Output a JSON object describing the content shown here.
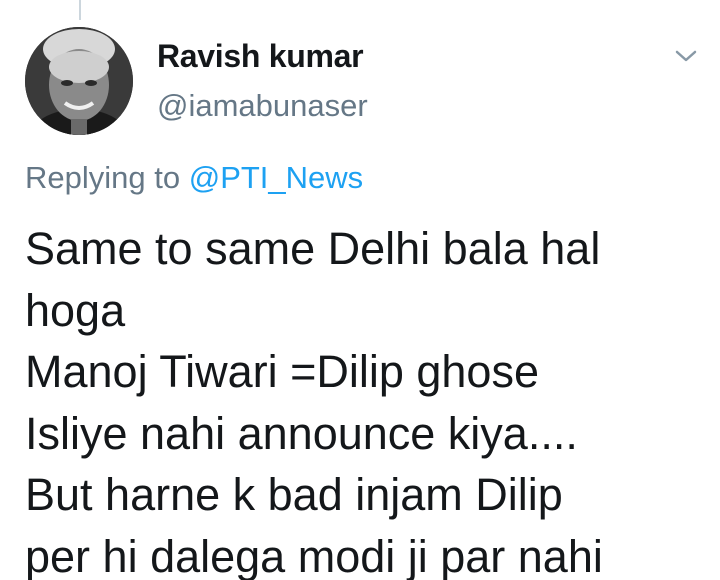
{
  "author": {
    "name": "Ravish kumar",
    "handle": "@iamabunaser",
    "avatar_icon": "profile-avatar"
  },
  "menu": {
    "icon": "chevron-down-icon"
  },
  "reply": {
    "prefix": "Replying to",
    "mention": "@PTI_News"
  },
  "tweet": {
    "lines": [
      "Same to same Delhi bala hal",
      "hoga",
      "Manoj Tiwari =Dilip ghose",
      "Isliye nahi announce kiya....",
      "But harne k bad injam Dilip",
      "per hi dalega modi ji par nahi"
    ]
  },
  "colors": {
    "text": "#14171a",
    "secondary": "#657786",
    "link": "#1da1f2",
    "thread_line": "#ccd6dd"
  }
}
